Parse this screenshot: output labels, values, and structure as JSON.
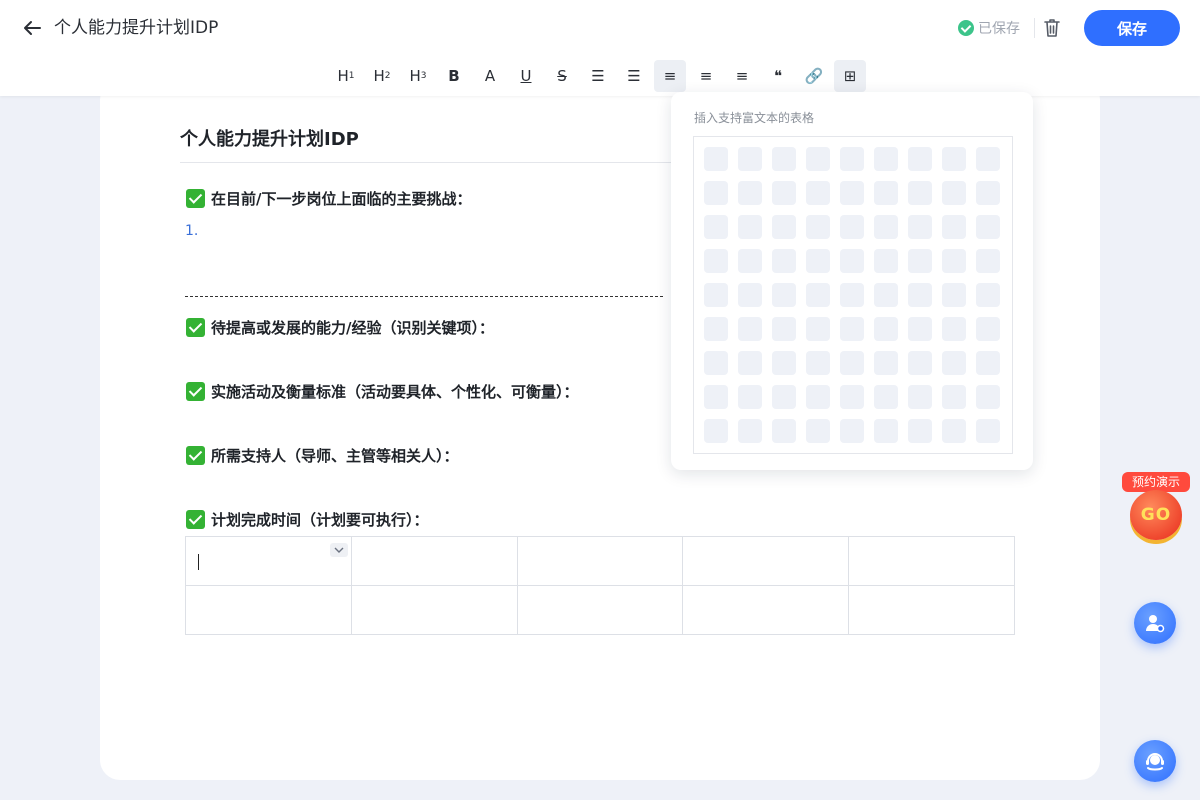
{
  "header": {
    "title": "个人能力提升计划IDP",
    "saved_status": "已保存",
    "save_label": "保存"
  },
  "toolbar": {
    "items": [
      {
        "name": "heading-1",
        "label": "H",
        "sub": "1"
      },
      {
        "name": "heading-2",
        "label": "H",
        "sub": "2"
      },
      {
        "name": "heading-3",
        "label": "H",
        "sub": "3"
      },
      {
        "name": "bold",
        "label": "B"
      },
      {
        "name": "font-color",
        "label": "A"
      },
      {
        "name": "underline",
        "label": "U"
      },
      {
        "name": "strikethrough",
        "label": "S"
      },
      {
        "name": "bullet-list",
        "label": "☰"
      },
      {
        "name": "ordered-list",
        "label": "☰"
      },
      {
        "name": "align-left",
        "label": "≡"
      },
      {
        "name": "align-center",
        "label": "≡"
      },
      {
        "name": "align-right",
        "label": "≡"
      },
      {
        "name": "quote",
        "label": "❝"
      },
      {
        "name": "link",
        "label": "🔗"
      },
      {
        "name": "table",
        "label": "⊞"
      }
    ],
    "active": [
      "align-left",
      "table"
    ]
  },
  "document": {
    "heading": "个人能力提升计划IDP",
    "sections": [
      "在目前/下一步岗位上面临的主要挑战：",
      "待提高或发展的能力/经验（识别关键项）：",
      "实施活动及衡量标准（活动要具体、个性化、可衡量）：",
      "所需支持人（导师、主管等相关人）：",
      "计划完成时间（计划要可执行）："
    ],
    "list_marker": "1.",
    "table": {
      "rows": 2,
      "cols": 5
    }
  },
  "table_picker": {
    "label": "插入支持富文本的表格",
    "rows": 9,
    "cols": 9
  },
  "promo": {
    "tag": "预约演示",
    "badge": "GO"
  },
  "colors": {
    "accent": "#2f6fff",
    "saved": "#3cc48a",
    "check": "#34b234",
    "list_number": "#3a6fd8"
  }
}
